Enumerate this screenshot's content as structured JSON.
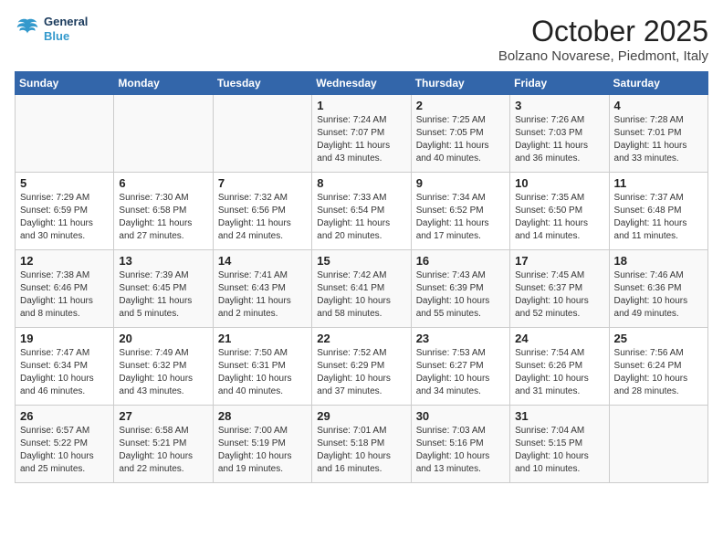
{
  "header": {
    "logo": "GeneralBlue",
    "title": "October 2025",
    "location": "Bolzano Novarese, Piedmont, Italy"
  },
  "weekdays": [
    "Sunday",
    "Monday",
    "Tuesday",
    "Wednesday",
    "Thursday",
    "Friday",
    "Saturday"
  ],
  "weeks": [
    [
      {
        "day": "",
        "info": ""
      },
      {
        "day": "",
        "info": ""
      },
      {
        "day": "",
        "info": ""
      },
      {
        "day": "1",
        "info": "Sunrise: 7:24 AM\nSunset: 7:07 PM\nDaylight: 11 hours\nand 43 minutes."
      },
      {
        "day": "2",
        "info": "Sunrise: 7:25 AM\nSunset: 7:05 PM\nDaylight: 11 hours\nand 40 minutes."
      },
      {
        "day": "3",
        "info": "Sunrise: 7:26 AM\nSunset: 7:03 PM\nDaylight: 11 hours\nand 36 minutes."
      },
      {
        "day": "4",
        "info": "Sunrise: 7:28 AM\nSunset: 7:01 PM\nDaylight: 11 hours\nand 33 minutes."
      }
    ],
    [
      {
        "day": "5",
        "info": "Sunrise: 7:29 AM\nSunset: 6:59 PM\nDaylight: 11 hours\nand 30 minutes."
      },
      {
        "day": "6",
        "info": "Sunrise: 7:30 AM\nSunset: 6:58 PM\nDaylight: 11 hours\nand 27 minutes."
      },
      {
        "day": "7",
        "info": "Sunrise: 7:32 AM\nSunset: 6:56 PM\nDaylight: 11 hours\nand 24 minutes."
      },
      {
        "day": "8",
        "info": "Sunrise: 7:33 AM\nSunset: 6:54 PM\nDaylight: 11 hours\nand 20 minutes."
      },
      {
        "day": "9",
        "info": "Sunrise: 7:34 AM\nSunset: 6:52 PM\nDaylight: 11 hours\nand 17 minutes."
      },
      {
        "day": "10",
        "info": "Sunrise: 7:35 AM\nSunset: 6:50 PM\nDaylight: 11 hours\nand 14 minutes."
      },
      {
        "day": "11",
        "info": "Sunrise: 7:37 AM\nSunset: 6:48 PM\nDaylight: 11 hours\nand 11 minutes."
      }
    ],
    [
      {
        "day": "12",
        "info": "Sunrise: 7:38 AM\nSunset: 6:46 PM\nDaylight: 11 hours\nand 8 minutes."
      },
      {
        "day": "13",
        "info": "Sunrise: 7:39 AM\nSunset: 6:45 PM\nDaylight: 11 hours\nand 5 minutes."
      },
      {
        "day": "14",
        "info": "Sunrise: 7:41 AM\nSunset: 6:43 PM\nDaylight: 11 hours\nand 2 minutes."
      },
      {
        "day": "15",
        "info": "Sunrise: 7:42 AM\nSunset: 6:41 PM\nDaylight: 10 hours\nand 58 minutes."
      },
      {
        "day": "16",
        "info": "Sunrise: 7:43 AM\nSunset: 6:39 PM\nDaylight: 10 hours\nand 55 minutes."
      },
      {
        "day": "17",
        "info": "Sunrise: 7:45 AM\nSunset: 6:37 PM\nDaylight: 10 hours\nand 52 minutes."
      },
      {
        "day": "18",
        "info": "Sunrise: 7:46 AM\nSunset: 6:36 PM\nDaylight: 10 hours\nand 49 minutes."
      }
    ],
    [
      {
        "day": "19",
        "info": "Sunrise: 7:47 AM\nSunset: 6:34 PM\nDaylight: 10 hours\nand 46 minutes."
      },
      {
        "day": "20",
        "info": "Sunrise: 7:49 AM\nSunset: 6:32 PM\nDaylight: 10 hours\nand 43 minutes."
      },
      {
        "day": "21",
        "info": "Sunrise: 7:50 AM\nSunset: 6:31 PM\nDaylight: 10 hours\nand 40 minutes."
      },
      {
        "day": "22",
        "info": "Sunrise: 7:52 AM\nSunset: 6:29 PM\nDaylight: 10 hours\nand 37 minutes."
      },
      {
        "day": "23",
        "info": "Sunrise: 7:53 AM\nSunset: 6:27 PM\nDaylight: 10 hours\nand 34 minutes."
      },
      {
        "day": "24",
        "info": "Sunrise: 7:54 AM\nSunset: 6:26 PM\nDaylight: 10 hours\nand 31 minutes."
      },
      {
        "day": "25",
        "info": "Sunrise: 7:56 AM\nSunset: 6:24 PM\nDaylight: 10 hours\nand 28 minutes."
      }
    ],
    [
      {
        "day": "26",
        "info": "Sunrise: 6:57 AM\nSunset: 5:22 PM\nDaylight: 10 hours\nand 25 minutes."
      },
      {
        "day": "27",
        "info": "Sunrise: 6:58 AM\nSunset: 5:21 PM\nDaylight: 10 hours\nand 22 minutes."
      },
      {
        "day": "28",
        "info": "Sunrise: 7:00 AM\nSunset: 5:19 PM\nDaylight: 10 hours\nand 19 minutes."
      },
      {
        "day": "29",
        "info": "Sunrise: 7:01 AM\nSunset: 5:18 PM\nDaylight: 10 hours\nand 16 minutes."
      },
      {
        "day": "30",
        "info": "Sunrise: 7:03 AM\nSunset: 5:16 PM\nDaylight: 10 hours\nand 13 minutes."
      },
      {
        "day": "31",
        "info": "Sunrise: 7:04 AM\nSunset: 5:15 PM\nDaylight: 10 hours\nand 10 minutes."
      },
      {
        "day": "",
        "info": ""
      }
    ]
  ]
}
